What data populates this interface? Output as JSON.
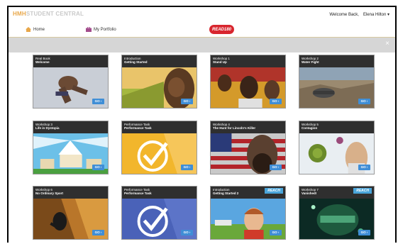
{
  "header": {
    "brand_prefix": "HMH",
    "brand_name": "STUDENT CENTRAL",
    "welcome": "Welcome Back,",
    "user": "Elena Hilton"
  },
  "nav": {
    "home": "Home",
    "portfolio": "My Portfolio",
    "read_button": "READ180"
  },
  "tiles": [
    {
      "line1": "Real Book",
      "line2": "Welcome",
      "go": "GO ›",
      "reach": ""
    },
    {
      "line1": "Introduction",
      "line2": "Getting Started",
      "go": "GO ›",
      "reach": ""
    },
    {
      "line1": "Workshop 1",
      "line2": "Stand Up",
      "go": "GO ›",
      "reach": ""
    },
    {
      "line1": "Workshop 2",
      "line2": "Water Fight",
      "go": "GO ›",
      "reach": ""
    },
    {
      "line1": "Workshop 3",
      "line2": "Life in Dystopia",
      "go": "GO ›",
      "reach": ""
    },
    {
      "line1": "Performance Task",
      "line2": "Performance Task",
      "go": "GO ›",
      "reach": ""
    },
    {
      "line1": "Workshop 4",
      "line2": "The Hunt for Lincoln's Killer",
      "go": "GO ›",
      "reach": ""
    },
    {
      "line1": "Workshop 5",
      "line2": "Contagion",
      "go": "GO ›",
      "reach": ""
    },
    {
      "line1": "Workshop 6",
      "line2": "No Ordinary Sport",
      "go": "GO ›",
      "reach": ""
    },
    {
      "line1": "Performance Task",
      "line2": "Performance Task",
      "go": "GO ›",
      "reach": ""
    },
    {
      "line1": "Introduction",
      "line2": "Getting Started 2",
      "go": "GO ›",
      "reach": "REACH"
    },
    {
      "line1": "Workshop 7",
      "line2": "Vanished!",
      "go": "GO ›",
      "reach": "REACH"
    }
  ]
}
